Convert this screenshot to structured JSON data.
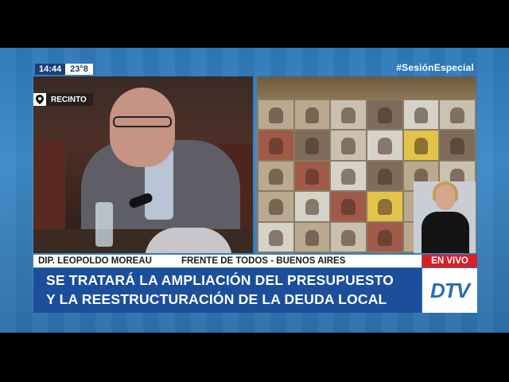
{
  "overlay": {
    "time": "14:44",
    "temperature": "23°8",
    "hashtag": "#SesiónEspecial",
    "location": "RECINTO"
  },
  "lower_third": {
    "speaker_name": "DIP. LEOPOLDO MOREAU",
    "party_region": "FRENTE DE TODOS -  BUENOS AIRES",
    "live_badge": "EN VIVO",
    "headline_line1": "SE TRATARÁ LA AMPLIACIÓN DEL PRESUPUESTO",
    "headline_line2": "Y LA REESTRUCTURACIÓN DE LA DEUDA LOCAL",
    "channel_logo": "DTV"
  },
  "colors": {
    "headline_bg": "#1b4f9c",
    "live_red": "#d91e26",
    "frame_blue": "#3e8ac6"
  },
  "icons": {
    "location": "map-pin-icon"
  }
}
